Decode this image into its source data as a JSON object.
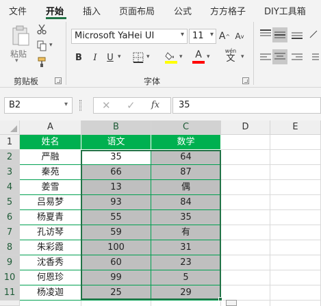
{
  "ribbon": {
    "tabs": [
      "文件",
      "开始",
      "插入",
      "页面布局",
      "公式",
      "方方格子",
      "DIY工具箱"
    ],
    "active_tab": "开始",
    "groups": {
      "clipboard": "剪贴板",
      "font": "字体"
    },
    "paste_label": "粘贴",
    "font_name": "Microsoft YaHei UI",
    "font_size": "11",
    "bold": "B",
    "italic": "I",
    "underline": "U",
    "font_color_glyph": "A",
    "grow_font": "A",
    "shrink_font": "A",
    "wen_glyph": "wén",
    "accent_color": "#217346",
    "highlight_color": "#ffff00",
    "font_color": "#ff0000"
  },
  "formula_bar": {
    "name_box": "B2",
    "fx": "fx",
    "value": "35"
  },
  "sheet": {
    "columns": [
      "A",
      "B",
      "C",
      "D",
      "E"
    ],
    "rows": [
      "1",
      "2",
      "3",
      "4",
      "5",
      "6",
      "7",
      "8",
      "9",
      "10",
      "11"
    ],
    "header": [
      "姓名",
      "语文",
      "数学"
    ],
    "data": [
      [
        "严融",
        "35",
        "64"
      ],
      [
        "秦苑",
        "66",
        "87"
      ],
      [
        "姜雪",
        "13",
        "偶"
      ],
      [
        "吕易梦",
        "93",
        "84"
      ],
      [
        "杨夏青",
        "55",
        "35"
      ],
      [
        "孔访琴",
        "59",
        "有"
      ],
      [
        "朱彩霞",
        "100",
        "31"
      ],
      [
        "沈香秀",
        "60",
        "23"
      ],
      [
        "何恩珍",
        "99",
        "5"
      ],
      [
        "杨凌迦",
        "25",
        "29"
      ]
    ],
    "header_color": "#00b050",
    "selection_fill": "#bfbfbf"
  }
}
